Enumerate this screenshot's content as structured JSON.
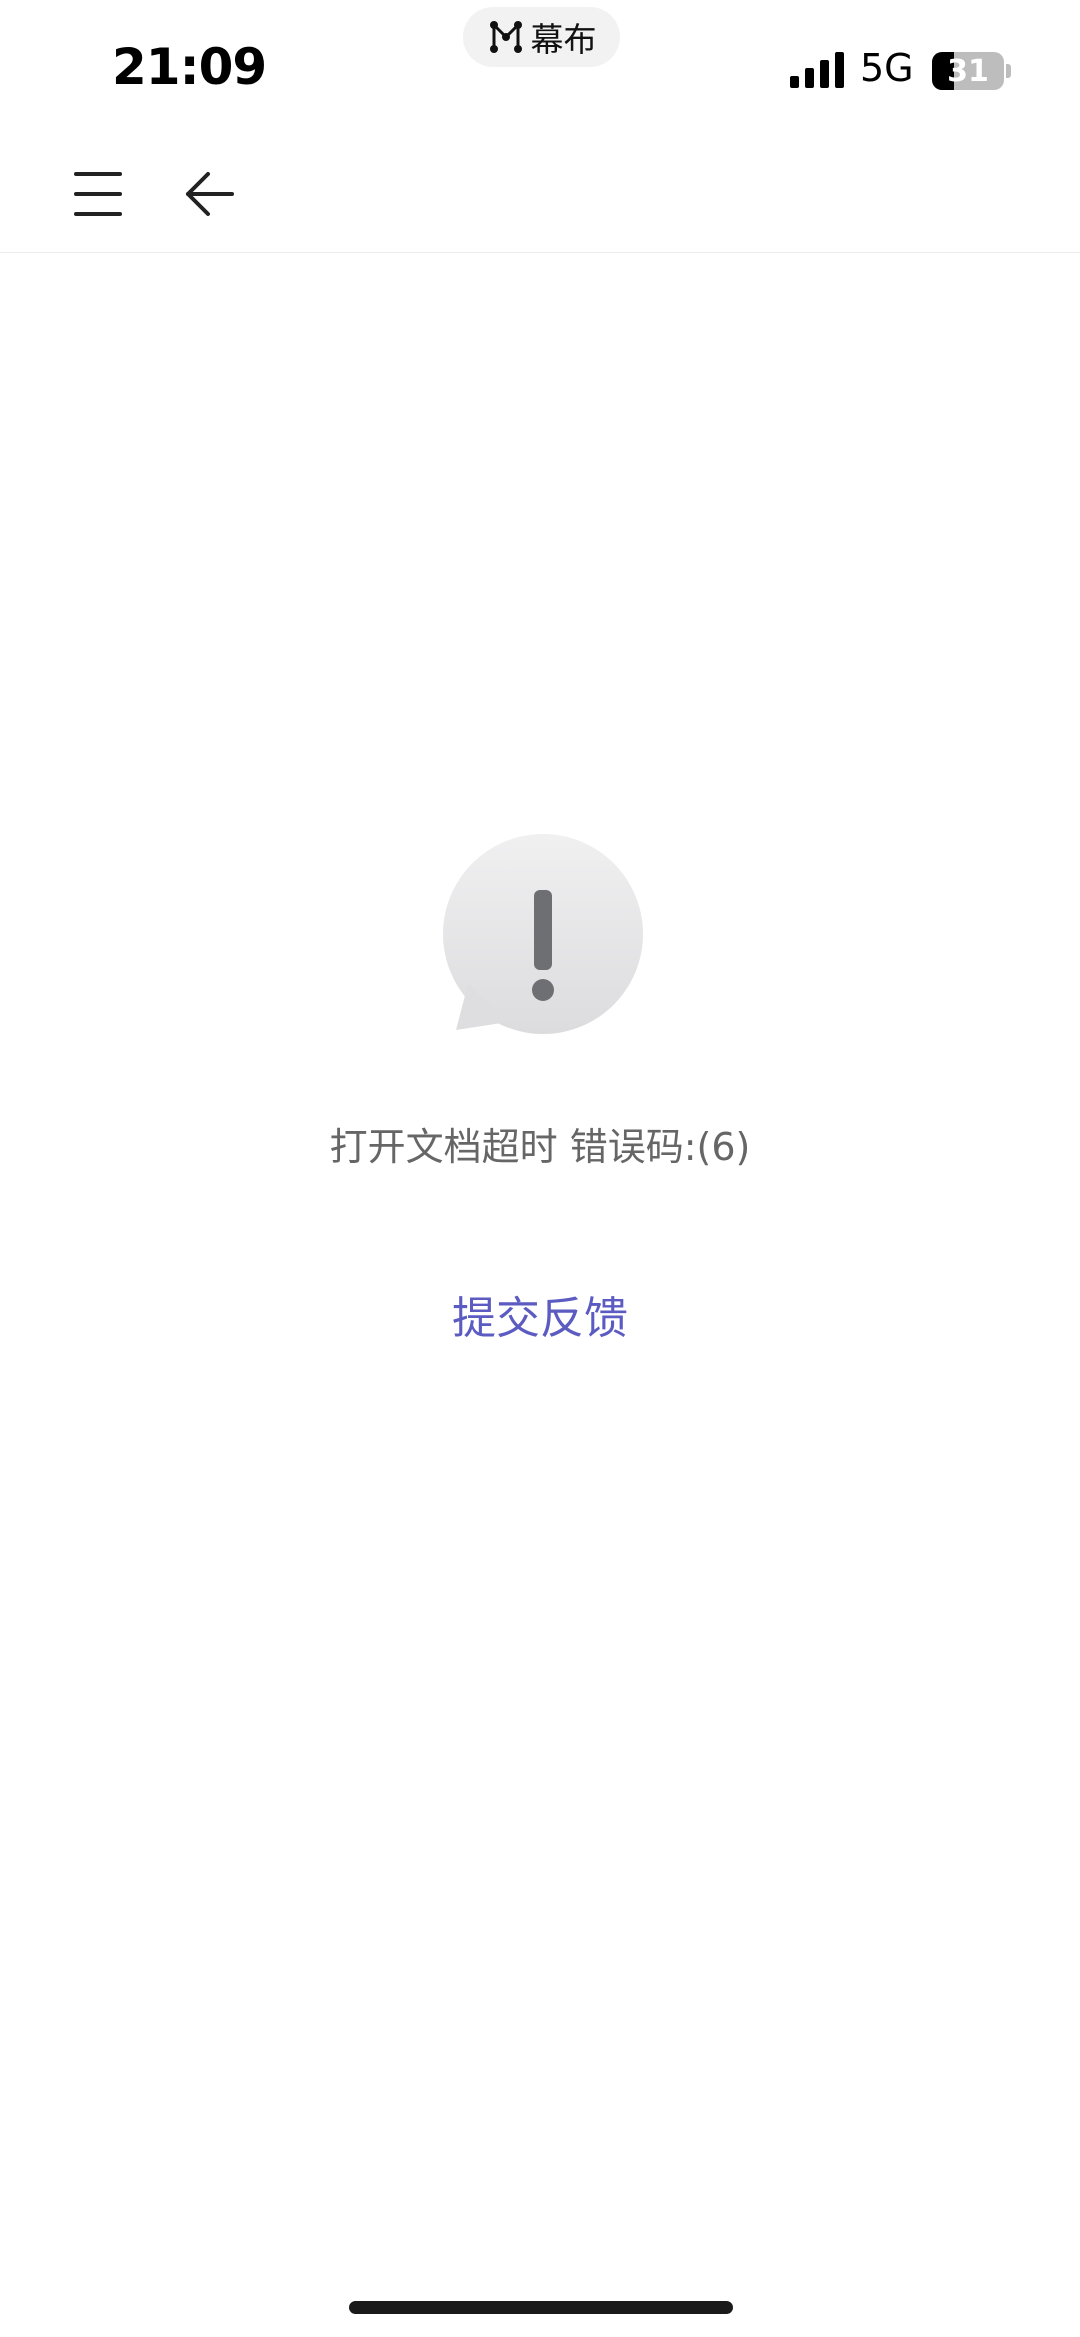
{
  "status_bar": {
    "time": "21:09",
    "app_pill": {
      "label": "幕布",
      "icon": "mubu-logo-icon"
    },
    "signal_icon": "cellular-signal-icon",
    "network": "5G",
    "battery": {
      "level_text": "31",
      "level_percent": 31
    }
  },
  "toolbar": {
    "menu_icon": "hamburger-menu-icon",
    "back_icon": "back-arrow-icon"
  },
  "error": {
    "icon": "alert-bubble-icon",
    "message": "打开文档超时 错误码:(6)",
    "feedback_label": "提交反馈"
  },
  "colors": {
    "background": "#ffffff",
    "message_text": "#666666",
    "link": "#5b5bc2",
    "icon_gray": "#6e6f73"
  }
}
